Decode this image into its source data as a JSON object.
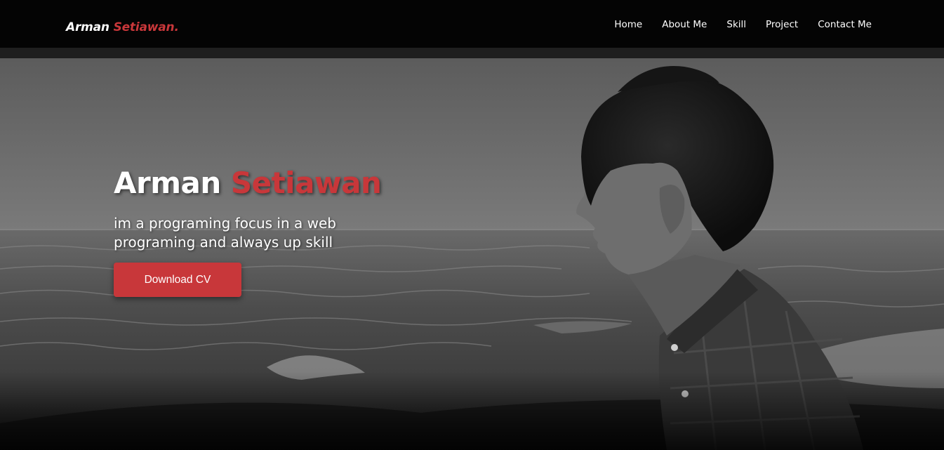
{
  "brand": {
    "first": "Arman",
    "last": "Setiawan."
  },
  "nav": {
    "items": [
      {
        "label": "Home"
      },
      {
        "label": "About Me"
      },
      {
        "label": "Skill"
      },
      {
        "label": "Project"
      },
      {
        "label": "Contact Me"
      }
    ]
  },
  "hero": {
    "title_first": "Arman",
    "title_last": "Setiawan",
    "description": "im a programing focus in a web programing and always up skill",
    "cta_label": "Download CV"
  },
  "colors": {
    "accent": "#c8373a",
    "navbar": "#040404",
    "text": "#ffffff"
  }
}
